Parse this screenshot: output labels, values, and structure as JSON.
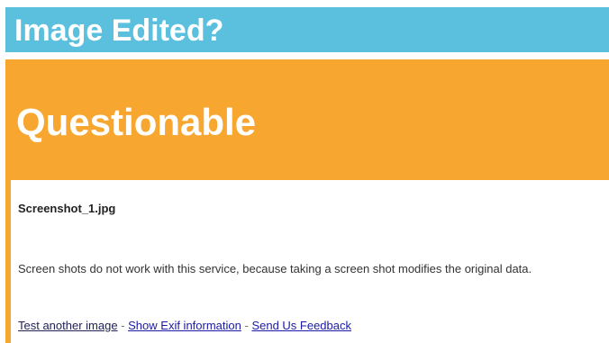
{
  "header": {
    "title": "Image Edited?"
  },
  "result": {
    "verdict": "Questionable",
    "file_name": "Screenshot_1.jpg",
    "message": "Screen shots do not work with this service, because taking a screen shot modifies the original data."
  },
  "links": {
    "test_another": "Test another image",
    "show_exif": "Show Exif information",
    "send_feedback": "Send Us Feedback",
    "separator": " - "
  },
  "colors": {
    "header_bg": "#5bc0de",
    "verdict_bg": "#f7a630",
    "link": "#1a1aa6"
  }
}
